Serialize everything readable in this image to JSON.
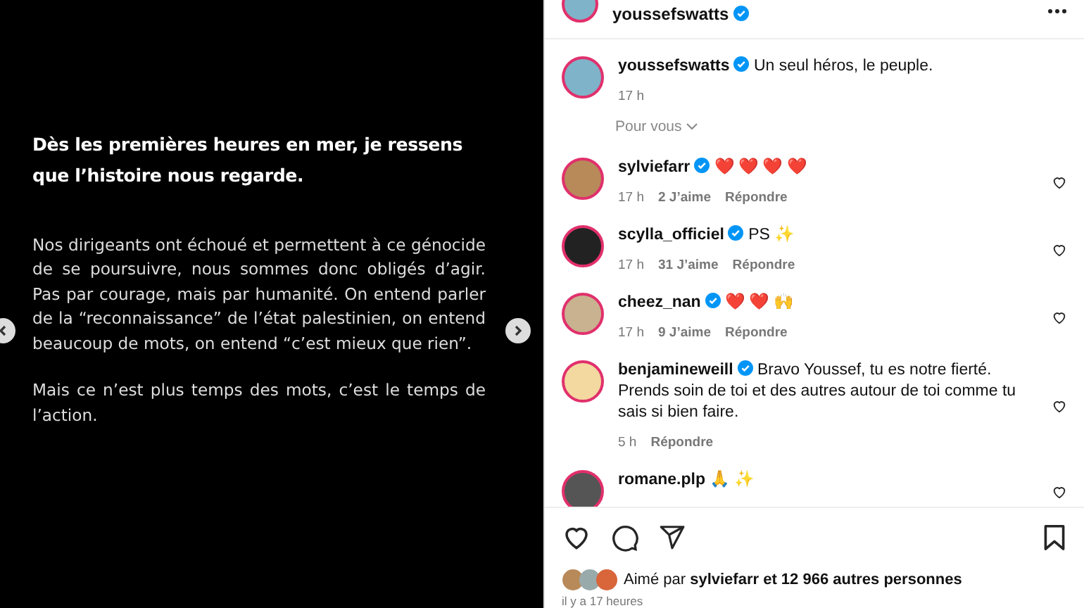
{
  "post_slide": {
    "heading": "Dès les premières heures en mer, je ressens que l’histoire nous regarde.",
    "paragraphs": [
      "Nos dirigeants ont échoué et permettent à ce génocide de se poursuivre, nous sommes donc obligés d’agir. Pas par courage, mais par humanité. On entend parler de la “reconnaissance” de l’état palestinien, on entend beaucoup de mots, on entend “c’est mieux que rien”.",
      "Mais ce n’est plus temps des mots, c’est le temps de l’action."
    ]
  },
  "header": {
    "username": "youssefswatts",
    "verified": true
  },
  "caption": {
    "username": "youssefswatts",
    "verified": true,
    "text": "Un seul héros, le peuple.",
    "time": "17 h"
  },
  "sort": {
    "label": "Pour vous"
  },
  "comments": [
    {
      "username": "sylviefarr",
      "verified": true,
      "text": "❤️ ❤️ ❤️ ❤️",
      "time": "17 h",
      "likes": "2 J’aime",
      "reply": "Répondre",
      "liked": false
    },
    {
      "username": "scylla_officiel",
      "verified": true,
      "text": "PS ✨",
      "time": "17 h",
      "likes": "31 J’aime",
      "reply": "Répondre",
      "liked": false
    },
    {
      "username": "cheez_nan",
      "verified": true,
      "text": "❤️ ❤️ 🙌",
      "time": "17 h",
      "likes": "9 J’aime",
      "reply": "Répondre",
      "liked": false
    },
    {
      "username": "benjamineweill",
      "verified": true,
      "text": "Bravo Youssef, tu es notre fierté. Prends soin de toi et des autres autour de toi comme tu sais si bien faire.",
      "time": "5 h",
      "reply": "Répondre",
      "liked": false
    },
    {
      "username": "romane.plp",
      "verified": false,
      "text": "🙏 ✨",
      "liked": false
    }
  ],
  "actions": {
    "liked": false,
    "saved": false
  },
  "likes": {
    "prefix": "Aimé par",
    "user": "sylviefarr",
    "suffix": "et 12 966 autres personnes"
  },
  "timestamp": "il y a 17 heures"
}
